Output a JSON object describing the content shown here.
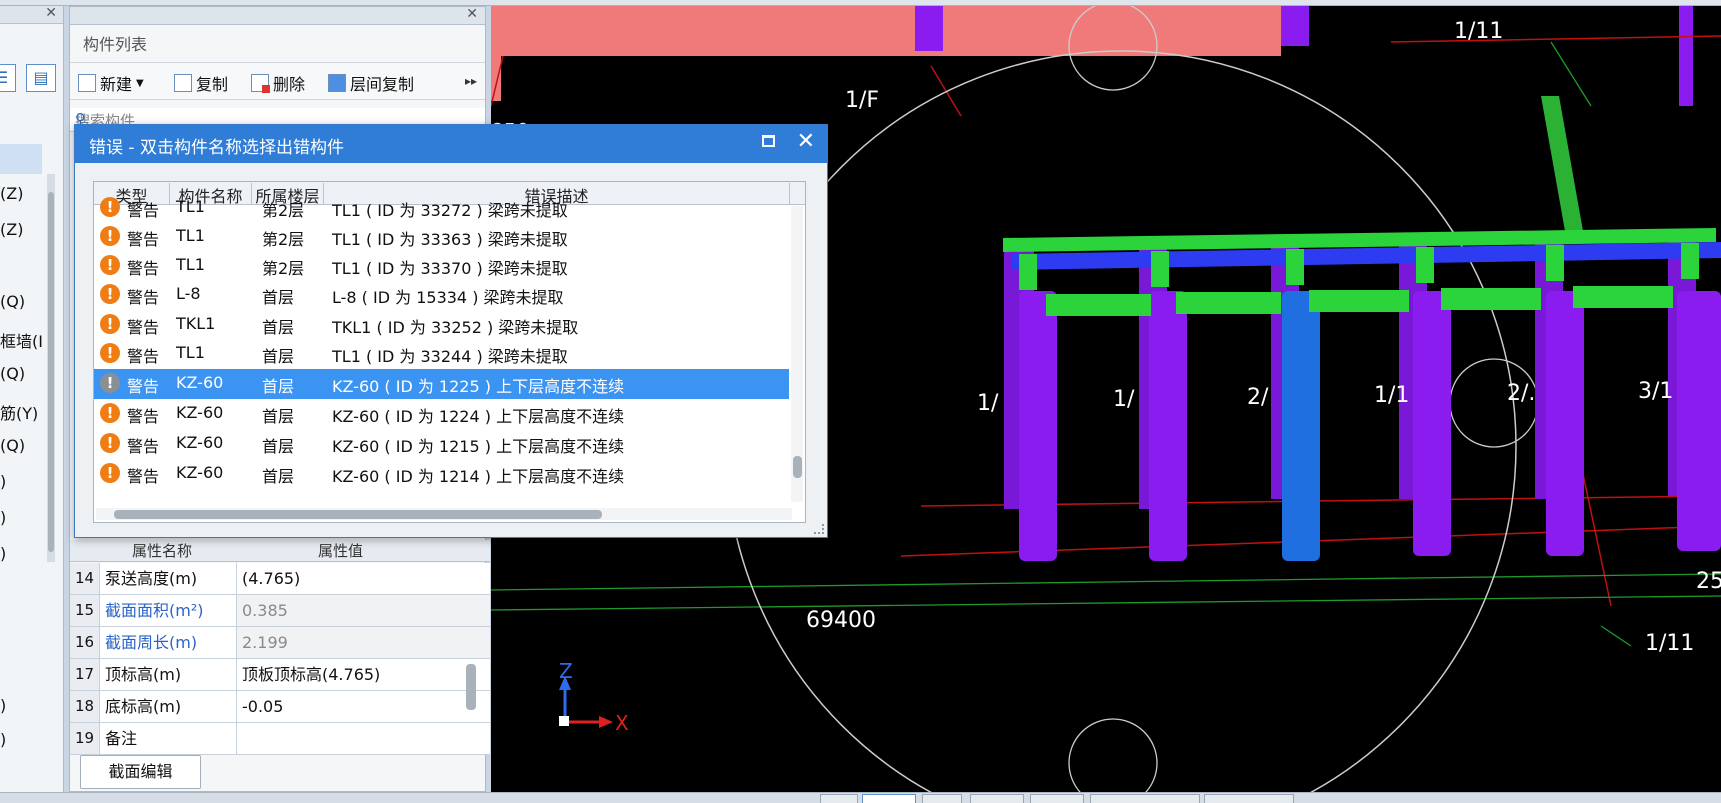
{
  "left_panel": {
    "items": [
      "(Z)",
      "(Z)",
      "(Q)",
      "框墙(I",
      "(Q)",
      "筋(Y)",
      "(Q)",
      ")",
      ")",
      ")",
      ")",
      ")"
    ]
  },
  "component_panel": {
    "title": "构件列表",
    "toolbar": {
      "new_label": "新建",
      "copy_label": "复制",
      "delete_label": "删除",
      "floor_copy_label": "层间复制"
    },
    "search_placeholder": "搜索构件..."
  },
  "properties": {
    "header_name": "属性名称",
    "header_value": "属性值",
    "rows": [
      {
        "num": "14",
        "name": "泵送高度(m)",
        "value": "(4.765)",
        "blue": false
      },
      {
        "num": "15",
        "name": "截面面积(m²)",
        "value": "0.385",
        "blue": true
      },
      {
        "num": "16",
        "name": "截面周长(m)",
        "value": "2.199",
        "blue": true
      },
      {
        "num": "17",
        "name": "顶标高(m)",
        "value": "顶板顶标高(4.765)",
        "blue": false
      },
      {
        "num": "18",
        "name": "底标高(m)",
        "value": "-0.05",
        "blue": false
      },
      {
        "num": "19",
        "name": "备注",
        "value": "",
        "blue": false
      }
    ],
    "section_edit_button": "截面编辑"
  },
  "error_dialog": {
    "title": "错误 - 双击构件名称选择出错构件",
    "columns": {
      "type": "类型",
      "name": "构件名称",
      "floor": "所属楼层",
      "desc": "错误描述"
    },
    "rows": [
      {
        "type": "警告",
        "name": "TL1",
        "floor": "第2层",
        "desc": "TL1 ( ID 为 33272 ) 梁跨未提取",
        "selected": false
      },
      {
        "type": "警告",
        "name": "TL1",
        "floor": "第2层",
        "desc": "TL1 ( ID 为 33363 ) 梁跨未提取",
        "selected": false
      },
      {
        "type": "警告",
        "name": "TL1",
        "floor": "第2层",
        "desc": "TL1 ( ID 为 33370 ) 梁跨未提取",
        "selected": false
      },
      {
        "type": "警告",
        "name": "L-8",
        "floor": "首层",
        "desc": "L-8 ( ID 为 15334 ) 梁跨未提取",
        "selected": false
      },
      {
        "type": "警告",
        "name": "TKL1",
        "floor": "首层",
        "desc": "TKL1 ( ID 为 33252 ) 梁跨未提取",
        "selected": false
      },
      {
        "type": "警告",
        "name": "TL1",
        "floor": "首层",
        "desc": "TL1 ( ID 为 33244 ) 梁跨未提取",
        "selected": false
      },
      {
        "type": "警告",
        "name": "KZ-60",
        "floor": "首层",
        "desc": "KZ-60 ( ID 为 1225 ) 上下层高度不连续",
        "selected": true
      },
      {
        "type": "警告",
        "name": "KZ-60",
        "floor": "首层",
        "desc": "KZ-60 ( ID 为 1224 ) 上下层高度不连续",
        "selected": false
      },
      {
        "type": "警告",
        "name": "KZ-60",
        "floor": "首层",
        "desc": "KZ-60 ( ID 为 1215 ) 上下层高度不连续",
        "selected": false
      },
      {
        "type": "警告",
        "name": "KZ-60",
        "floor": "首层",
        "desc": "KZ-60 ( ID 为 1214 ) 上下层高度不连续",
        "selected": false
      }
    ]
  },
  "viewport": {
    "labels": {
      "axis_1f": "1/F",
      "axis_1_11_top": "1/11",
      "axis_1_11_bottom": "1/11",
      "dim_69400": "69400",
      "dim_850": "850",
      "dim_25": "25",
      "axis_x": "X",
      "axis_z": "Z",
      "col_a": "1/",
      "col_b": "1/",
      "col_c": "2/",
      "col_d": "1/1",
      "col_e": "2/.",
      "col_f": "3/1"
    },
    "colors": {
      "column": "#8a1cf0",
      "selected_column": "#1f6fe0",
      "beam_green": "#2bd43a",
      "beam_blue": "#2d3cf0",
      "slab_red": "#f07a7a",
      "grid_line": "#c01010"
    }
  }
}
